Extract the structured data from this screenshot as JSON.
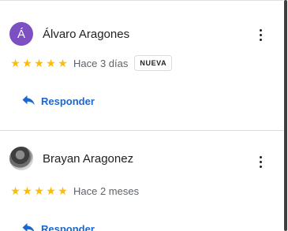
{
  "reviews": [
    {
      "avatar_letter": "Á",
      "avatar_color": "#7c4fc2",
      "name": "Álvaro Aragones",
      "stars": [
        "★",
        "★",
        "★",
        "★",
        "★"
      ],
      "rating": 5,
      "date": "Hace 3 días",
      "badge": "NUEVA",
      "reply_label": "Responder",
      "menu_icon": "more-vert-icon",
      "reply_icon": "reply-icon"
    },
    {
      "avatar_type": "photo",
      "name": "Brayan Aragonez",
      "stars": [
        "★",
        "★",
        "★",
        "★",
        "★"
      ],
      "rating": 5,
      "date": "Hace 2 meses",
      "reply_label": "Responder",
      "menu_icon": "more-vert-icon",
      "reply_icon": "reply-icon"
    }
  ],
  "colors": {
    "star": "#fbbc04",
    "accent": "#1967d2",
    "divider": "#dadce0",
    "text_secondary": "#5f6368"
  }
}
